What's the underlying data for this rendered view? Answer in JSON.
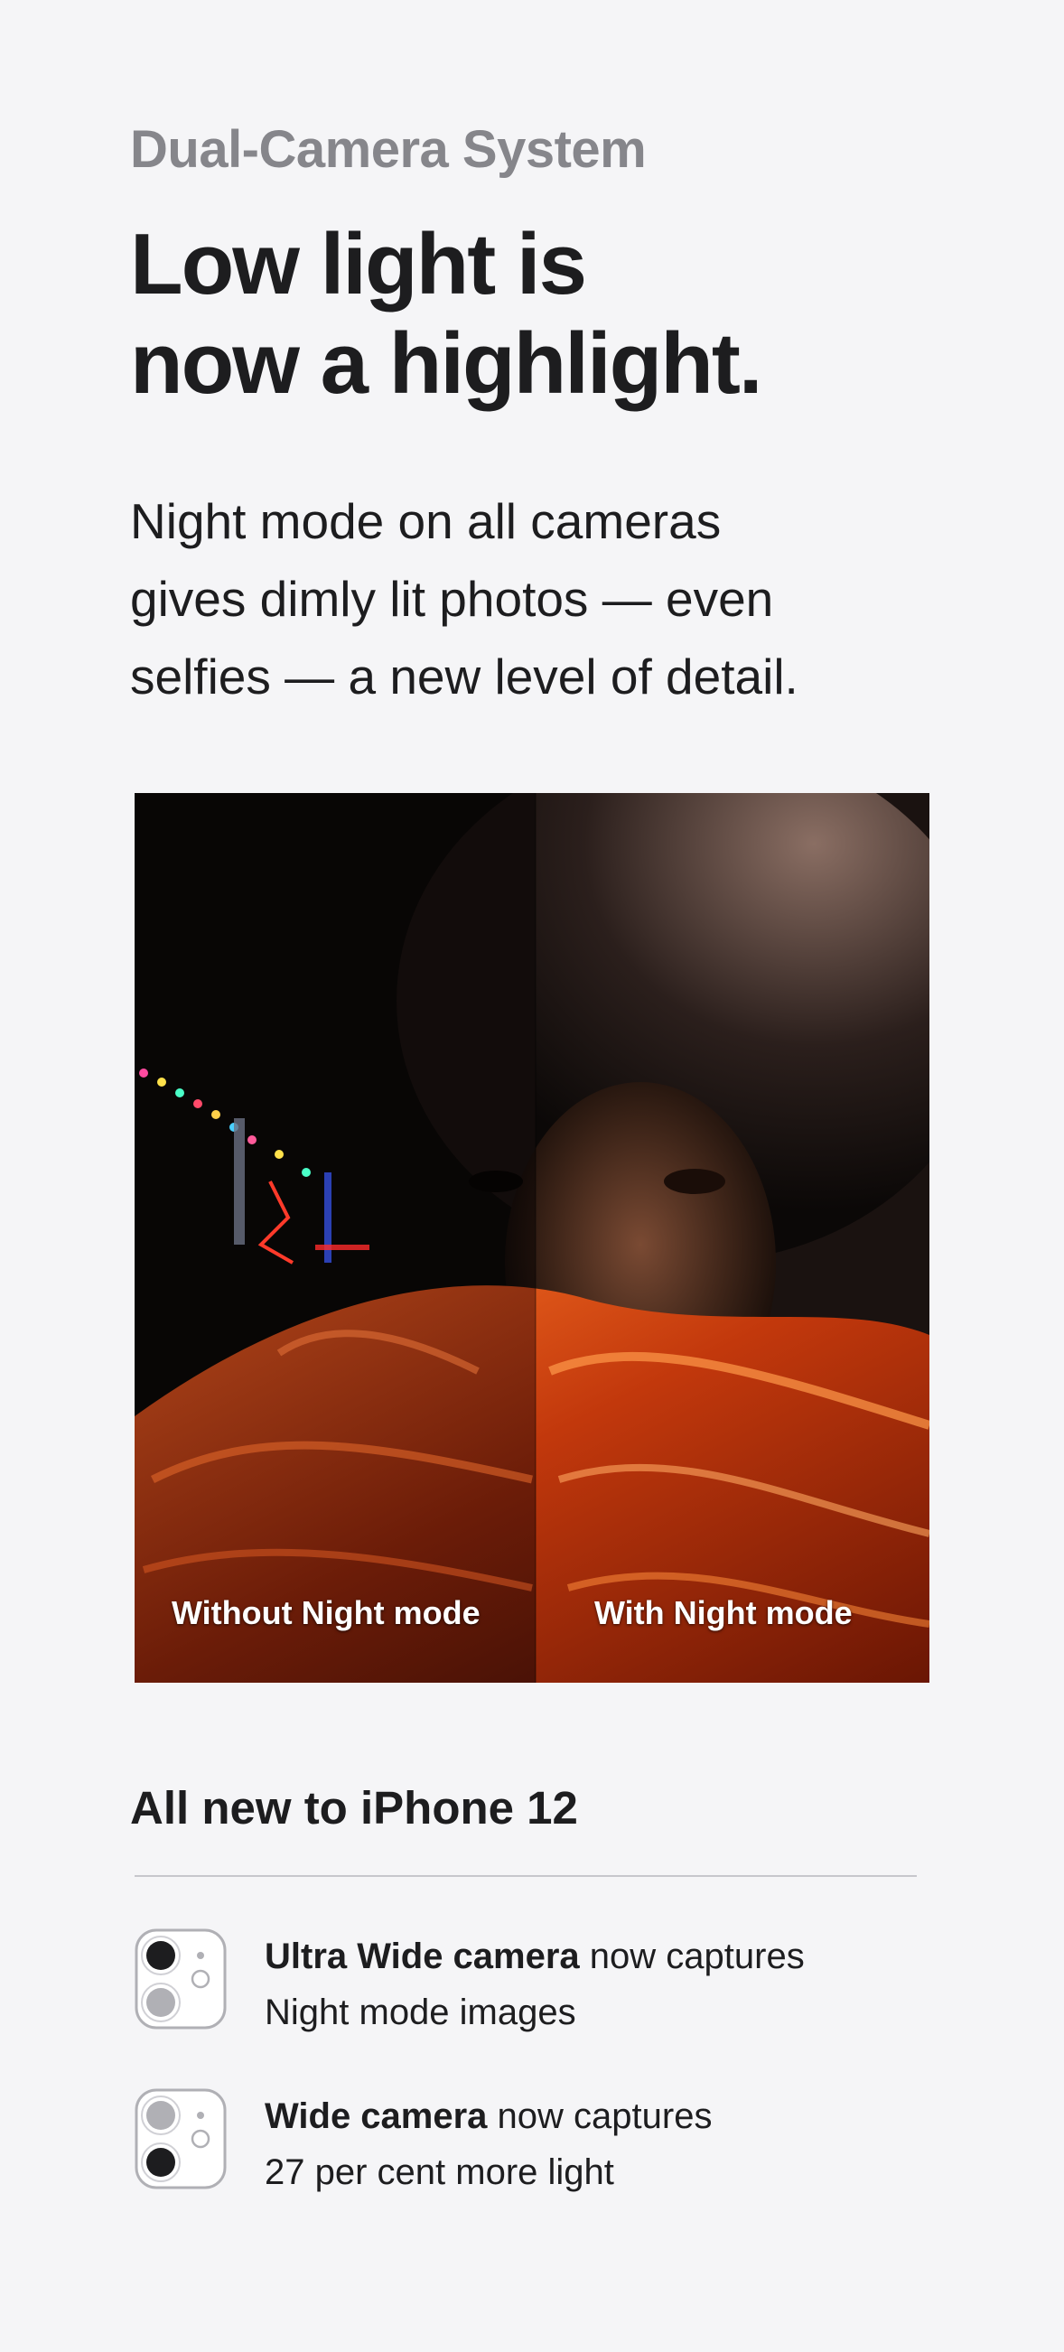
{
  "section": {
    "eyebrow": "Dual-Camera System",
    "headline_line1": "Low light is",
    "headline_line2": "now a highlight.",
    "intro_line1": "Night mode on all cameras",
    "intro_line2": "gives dimly lit photos — even",
    "intro_line3": "selfies — a new level of detail."
  },
  "comparison": {
    "left_caption": "Without Night mode",
    "right_caption": "With Night mode"
  },
  "features": {
    "title": "All new to iPhone 12",
    "items": [
      {
        "bold": "Ultra Wide camera",
        "rest": " now captures",
        "line2": "Night mode images",
        "icon": "ultra-wide-camera-icon"
      },
      {
        "bold": "Wide camera",
        "rest": " now captures",
        "line2": "27 per cent more light",
        "icon": "wide-camera-icon"
      }
    ]
  },
  "colors": {
    "background": "#f5f5f7",
    "eyebrow": "#86868b",
    "text": "#1d1d1f",
    "divider": "#c7c7cc"
  }
}
